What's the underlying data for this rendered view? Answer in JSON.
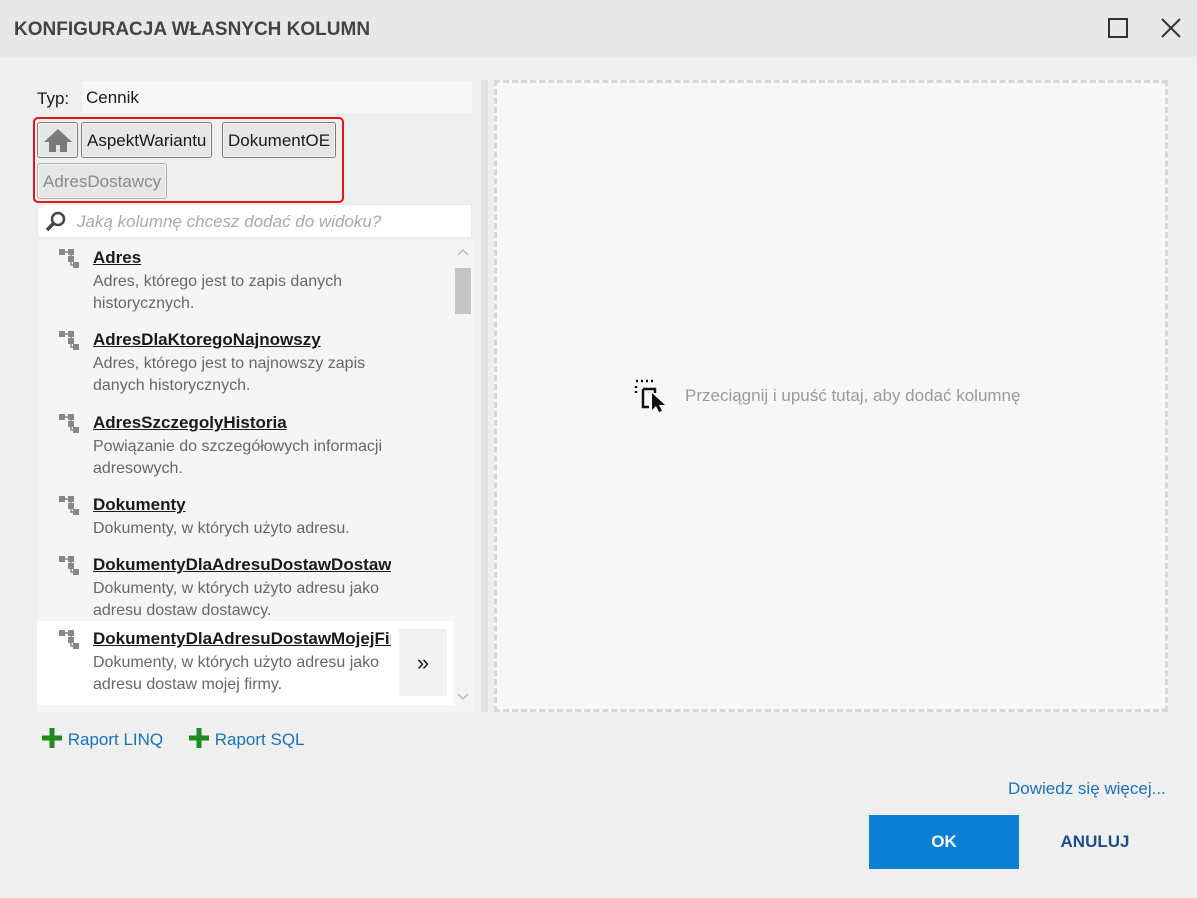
{
  "window": {
    "title": "KONFIGURACJA WŁASNYCH KOLUMN"
  },
  "type": {
    "label": "Typ:",
    "value": "Cennik"
  },
  "breadcrumbs": [
    {
      "label": "AspektWariantu"
    },
    {
      "label": "DokumentOE"
    },
    {
      "label": "AdresDostawcy"
    }
  ],
  "search": {
    "placeholder": "Jaką kolumnę chcesz dodać do widoku?"
  },
  "items": [
    {
      "name": "Adres",
      "desc": "Adres, którego jest to zapis danych historycznych."
    },
    {
      "name": "AdresDlaKtoregoNajnowszy",
      "desc": "Adres, którego jest to najnowszy zapis danych historycznych."
    },
    {
      "name": "AdresSzczegolyHistoria",
      "desc": "Powiązanie do szczegółowych informacji adresowych."
    },
    {
      "name": "Dokumenty",
      "desc": "Dokumenty, w których użyto adresu."
    },
    {
      "name": "DokumentyDlaAdresuDostawDostawcy",
      "desc": "Dokumenty, w których użyto adresu jako adresu dostaw dostawcy."
    },
    {
      "name": "DokumentyDlaAdresuDostawMojejFirmy",
      "desc": "Dokumenty, w których użyto adresu jako adresu dostaw mojej firmy."
    }
  ],
  "more_label": "»",
  "drop": {
    "text": "Przeciągnij i upuść tutaj, aby dodać kolumnę"
  },
  "actions": {
    "linq": "Raport LINQ",
    "sql": "Raport SQL",
    "learn_more": "Dowiedz się więcej...",
    "ok": "OK",
    "cancel": "ANULUJ"
  },
  "colors": {
    "accent": "#0a7fd3",
    "highlight": "#e0141e",
    "plus": "#1f8a1f"
  }
}
